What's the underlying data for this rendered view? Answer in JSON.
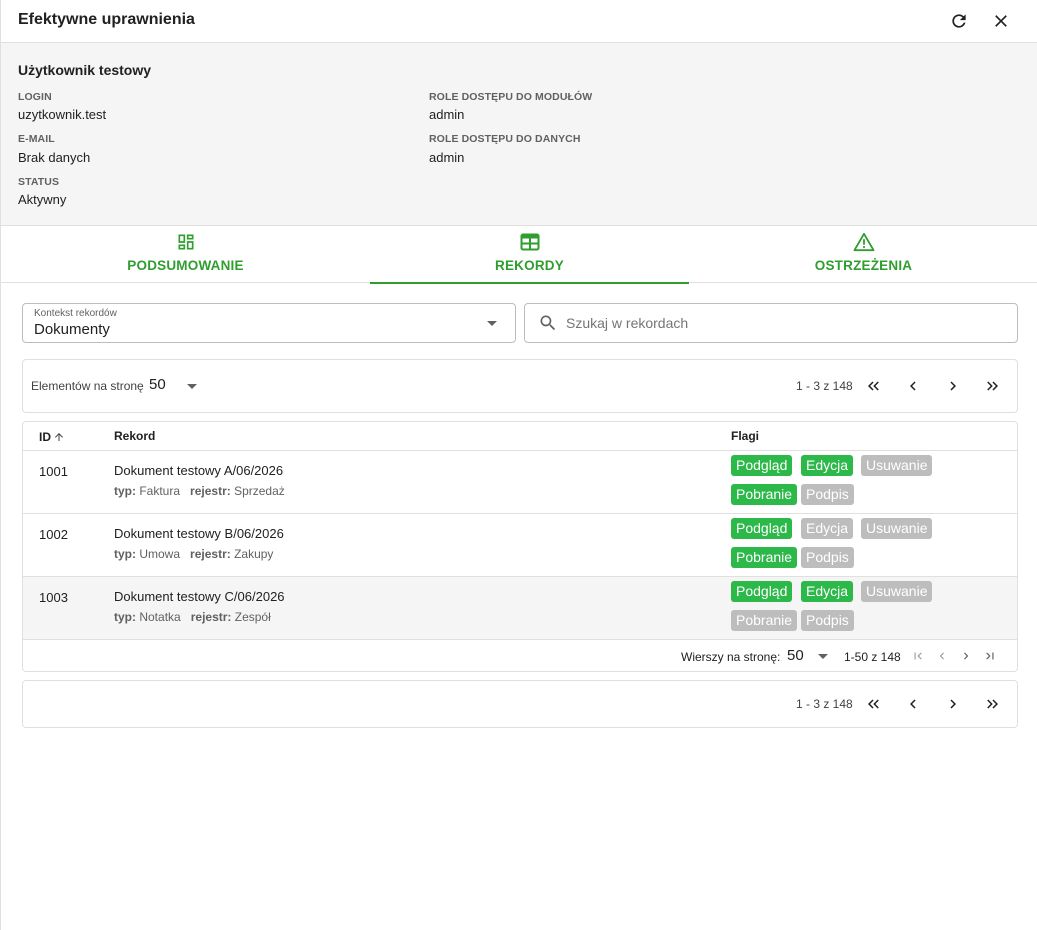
{
  "header": {
    "title": "Efektywne uprawnienia",
    "refresh_icon": "refresh-icon",
    "close_icon": "close-icon"
  },
  "user": {
    "name": "Użytkownik testowy",
    "login_label": "LOGIN",
    "login_value": "uzytkownik.test",
    "email_label": "E-MAIL",
    "email_value": "Brak danych",
    "status_label": "STATUS",
    "status_value": "Aktywny",
    "module_roles_label": "ROLE DOSTĘPU DO MODUŁÓW",
    "module_roles_value": "admin",
    "data_roles_label": "ROLE DOSTĘPU DO DANYCH",
    "data_roles_value": "admin"
  },
  "tabs": [
    {
      "label": "PODSUMOWANIE",
      "icon": "dashboard-icon",
      "active": false
    },
    {
      "label": "REKORDY",
      "icon": "table-icon",
      "active": true
    },
    {
      "label": "OSTRZEŻENIA",
      "icon": "warning-icon",
      "active": false
    }
  ],
  "filters": {
    "context_label": "Kontekst rekordów",
    "context_value": "Dokumenty",
    "search_placeholder": "Szukaj w rekordach"
  },
  "paginator_top": {
    "per_page_label": "Elementów na stronę",
    "per_page_value": "50",
    "range": "1 - 3 z 148"
  },
  "table": {
    "columns": {
      "id": "ID",
      "record": "Rekord",
      "flags": "Flagi"
    },
    "sort_icon": "arrow-up-icon",
    "type_label": "typ:",
    "register_label": "rejestr:",
    "rows": [
      {
        "id": "1001",
        "title": "Dokument testowy A/06/2026",
        "type": "Faktura",
        "register": "Sprzedaż",
        "flags": [
          {
            "label": "Podgląd",
            "on": true
          },
          {
            "label": "Edycja",
            "on": true
          },
          {
            "label": "Usuwanie",
            "on": false
          },
          {
            "label": "Pobranie",
            "on": true
          },
          {
            "label": "Podpis",
            "on": false
          }
        ]
      },
      {
        "id": "1002",
        "title": "Dokument testowy B/06/2026",
        "type": "Umowa",
        "register": "Zakupy",
        "flags": [
          {
            "label": "Podgląd",
            "on": true
          },
          {
            "label": "Edycja",
            "on": false
          },
          {
            "label": "Usuwanie",
            "on": false
          },
          {
            "label": "Pobranie",
            "on": true
          },
          {
            "label": "Podpis",
            "on": false
          }
        ]
      },
      {
        "id": "1003",
        "title": "Dokument testowy C/06/2026",
        "type": "Notatka",
        "register": "Zespół",
        "flags": [
          {
            "label": "Podgląd",
            "on": true
          },
          {
            "label": "Edycja",
            "on": true
          },
          {
            "label": "Usuwanie",
            "on": false
          },
          {
            "label": "Pobranie",
            "on": false
          },
          {
            "label": "Podpis",
            "on": false
          }
        ]
      }
    ],
    "footer": {
      "rows_label": "Wierszy na stronę:",
      "rows_value": "50",
      "range": "1-50 z 148"
    }
  },
  "paginator_bottom": {
    "range": "1 - 3 z 148"
  },
  "colors": {
    "accent": "#2e9e2e",
    "flag_on": "#2db84a",
    "flag_off": "#bdbdbd",
    "panel_bg": "#f5f5f5"
  }
}
